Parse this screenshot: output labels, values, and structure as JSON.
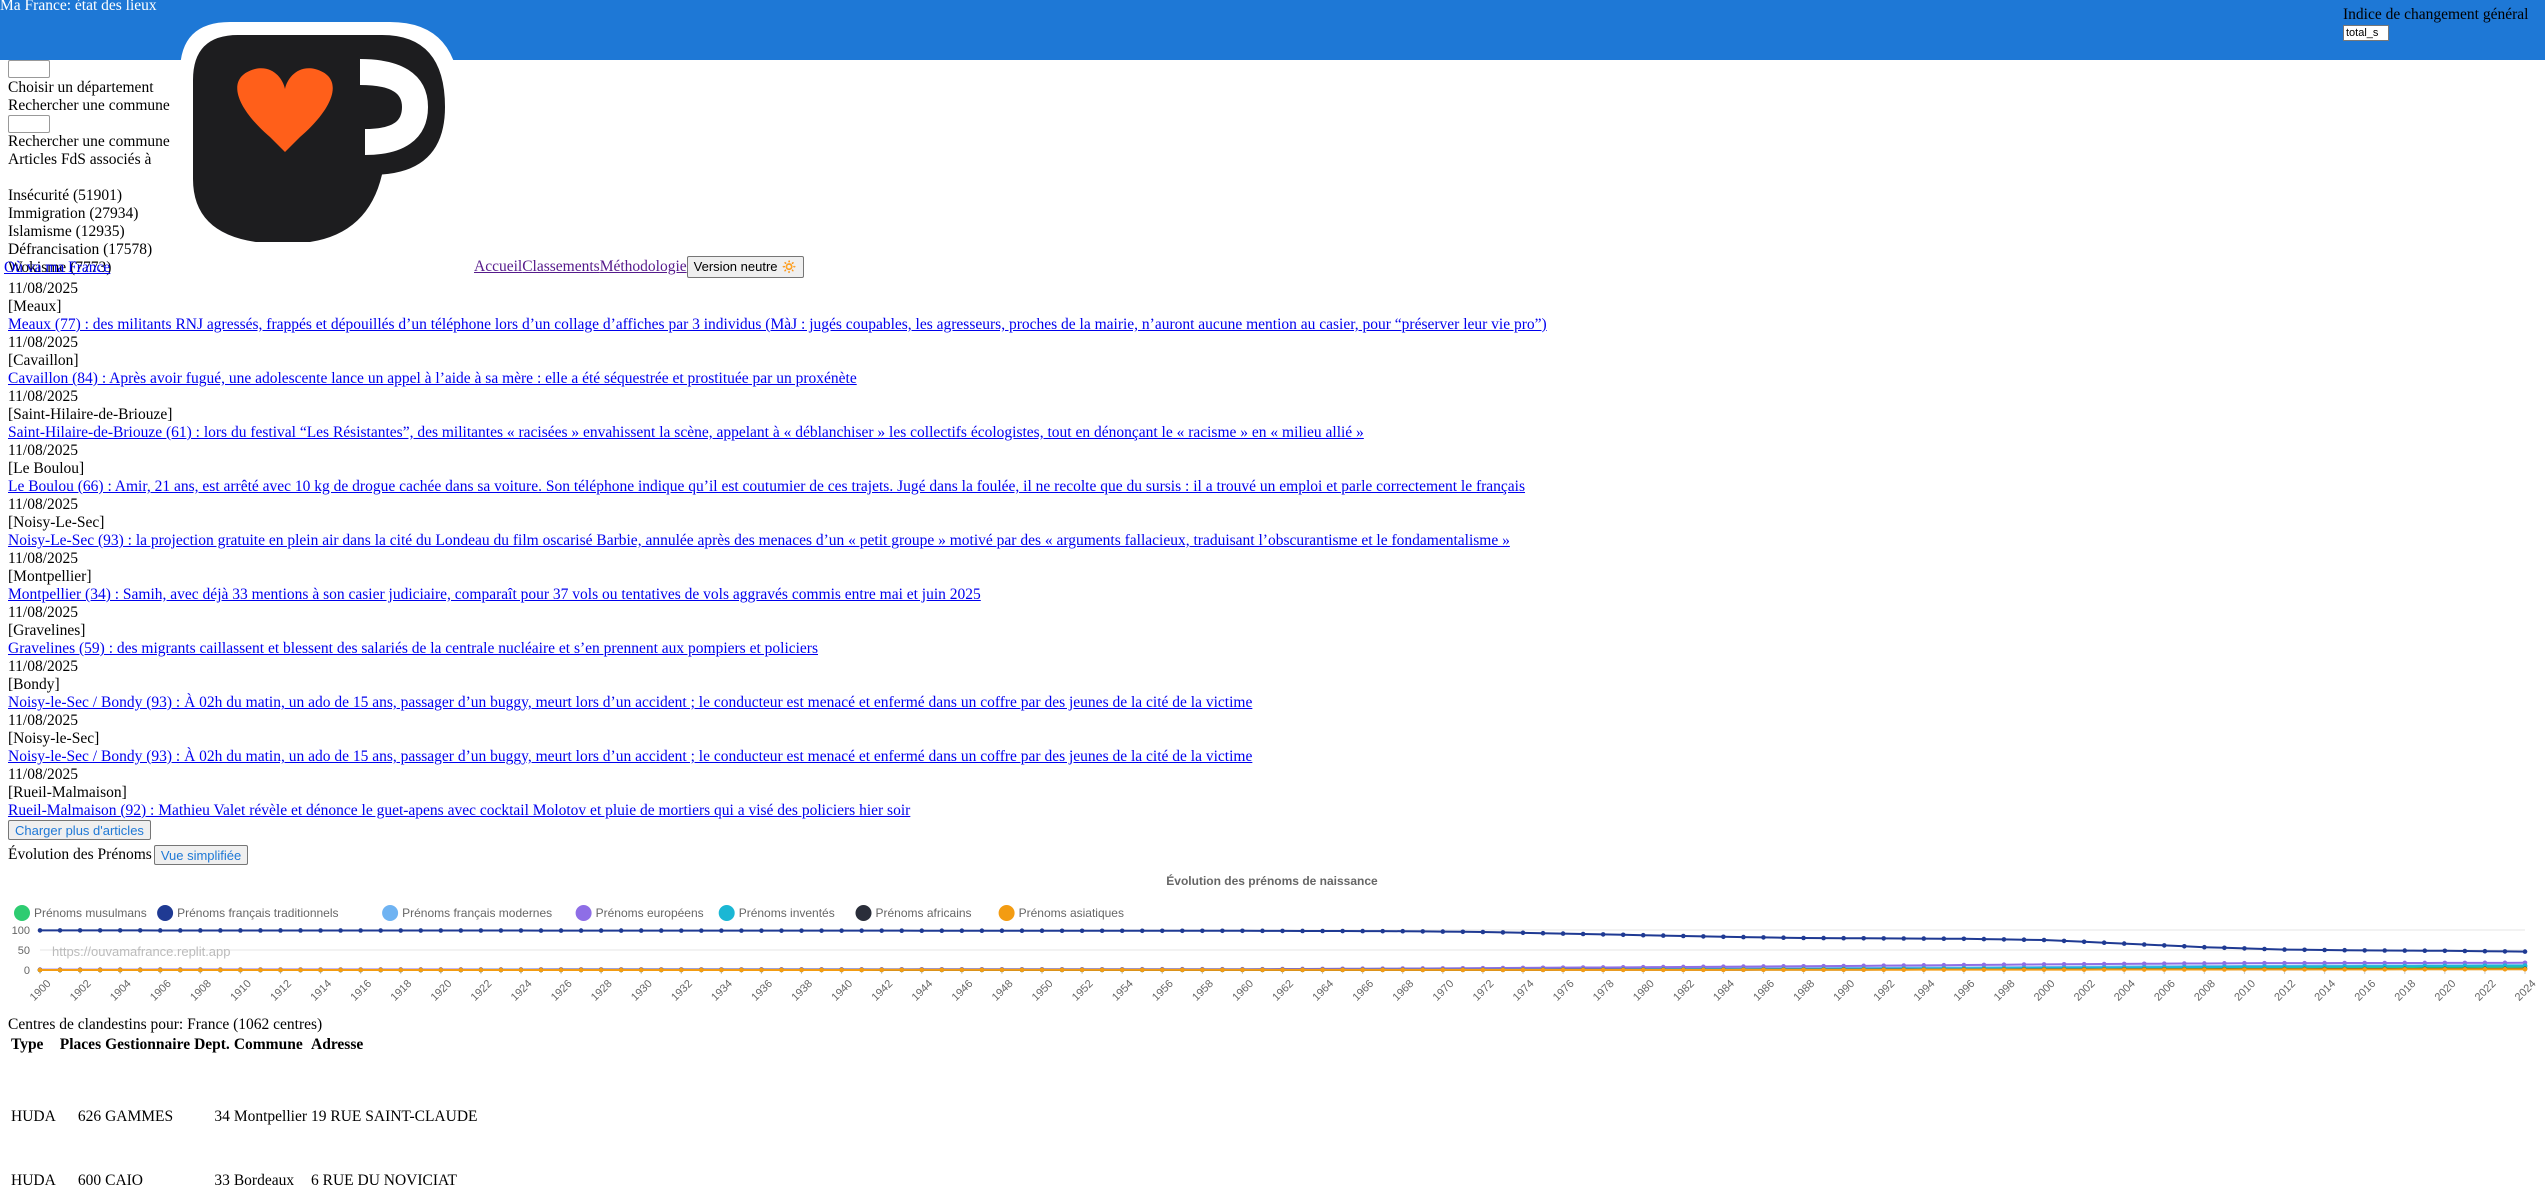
{
  "header": {
    "title": "Ma France: état des lieux",
    "indice_label": "Indice de changement général",
    "indice_value": "total_s"
  },
  "left": {
    "choose_dept": "Choisir un département",
    "search_commune": "Rechercher une commune",
    "search_commune_2": "Rechercher une commune",
    "articles_assoc": "Articles FdS associés à"
  },
  "categories": [
    "Insécurité (51901)",
    "Immigration (27934)",
    "Islamisme (12935)",
    "Défrancisation (17578)",
    "Wokisme (7773)"
  ],
  "nav": {
    "overlay_link": "Où va ma France",
    "accueil": "Accueil",
    "classements": "Classements",
    "methodologie": "Méthodologie",
    "neutral_button": "Version neutre 🔅"
  },
  "articles": [
    {
      "date": "11/08/2025",
      "place": "[Meaux]",
      "title": "Meaux (77) : des militants RNJ agressés, frappés et dépouillés d’un téléphone lors d’un collage d’affiches par 3 individus (MàJ : jugés coupables, les agresseurs, proches de la mairie, n’auront aucune mention au casier, pour “préserver leur vie pro”)"
    },
    {
      "date": "11/08/2025",
      "place": "[Cavaillon]",
      "title": "Cavaillon (84) : Après avoir fugué, une adolescente lance un appel à l’aide à sa mère : elle a été séquestrée et prostituée par un proxénète"
    },
    {
      "date": "11/08/2025",
      "place": "[Saint-Hilaire-de-Briouze]",
      "title": "Saint-Hilaire-de-Briouze (61) : lors du festival “Les Résistantes”, des militantes « racisées » envahissent la scène, appelant à « déblanchiser » les collectifs écologistes, tout en dénonçant le « racisme » en « milieu allié »"
    },
    {
      "date": "11/08/2025",
      "place": "[Le Boulou]",
      "title": "Le Boulou (66) : Amir, 21 ans, est arrêté avec 10 kg de drogue cachée dans sa voiture. Son téléphone indique qu’il est coutumier de ces trajets. Jugé dans la foulée, il ne recolte que du sursis : il a trouvé un emploi et parle correctement le français"
    },
    {
      "date": "11/08/2025",
      "place": "[Noisy-Le-Sec]",
      "title": "Noisy-Le-Sec (93) : la projection gratuite en plein air dans la cité du Londeau du film oscarisé Barbie, annulée après des menaces d’un « petit groupe » motivé par des « arguments fallacieux, traduisant l’obscurantisme et le fondamentalisme »"
    },
    {
      "date": "11/08/2025",
      "place": "[Montpellier]",
      "title": "Montpellier (34) : Samih, avec déjà 33 mentions à son casier judiciaire, comparaît pour 37 vols ou tentatives de vols aggravés commis entre mai et juin 2025"
    },
    {
      "date": "11/08/2025",
      "place": "[Gravelines]",
      "title": "Gravelines (59) : des migrants caillassent et blessent des salariés de la centrale nucléaire et s’en prennent aux pompiers et policiers"
    },
    {
      "date": "11/08/2025",
      "place": "[Bondy]",
      "title": "Noisy-le-Sec / Bondy (93) : À 02h du matin, un ado de 15 ans, passager d’un buggy, meurt lors d’un accident ; le conducteur est menacé et enfermé dans un coffre par des jeunes de la cité de la victime"
    },
    {
      "date": "11/08/2025",
      "place": "[Noisy-le-Sec]",
      "title": "Noisy-le-Sec / Bondy (93) : À 02h du matin, un ado de 15 ans, passager d’un buggy, meurt lors d’un accident ; le conducteur est menacé et enfermé dans un coffre par des jeunes de la cité de la victime"
    },
    {
      "date": "11/08/2025",
      "place": "[Rueil-Malmaison]",
      "title": "Rueil-Malmaison (92) : Mathieu Valet révèle et dénonce le guet-apens avec cocktail Molotov et pluie de mortiers qui a visé des policiers hier soir"
    }
  ],
  "load_more": "Charger plus d'articles",
  "prenoms": {
    "label": "Évolution des Prénoms",
    "simplified_button": "Vue simplifiée"
  },
  "chart_data": {
    "type": "line",
    "title": "Évolution des prénoms de naissance",
    "watermark": "https://ouvamafrance.replit.app",
    "ylim": [
      0,
      100
    ],
    "yticks": [
      0,
      50,
      100
    ],
    "x": [
      1900,
      1901,
      1902,
      1903,
      1904,
      1905,
      1906,
      1907,
      1908,
      1909,
      1910,
      1911,
      1912,
      1913,
      1914,
      1915,
      1916,
      1917,
      1918,
      1919,
      1920,
      1921,
      1922,
      1923,
      1924,
      1925,
      1926,
      1927,
      1928,
      1929,
      1930,
      1931,
      1932,
      1933,
      1934,
      1935,
      1936,
      1937,
      1938,
      1939,
      1940,
      1941,
      1942,
      1943,
      1944,
      1945,
      1946,
      1947,
      1948,
      1949,
      1950,
      1951,
      1952,
      1953,
      1954,
      1955,
      1956,
      1957,
      1958,
      1959,
      1960,
      1961,
      1962,
      1963,
      1964,
      1965,
      1966,
      1967,
      1968,
      1969,
      1970,
      1971,
      1972,
      1973,
      1974,
      1975,
      1976,
      1977,
      1978,
      1979,
      1980,
      1981,
      1982,
      1983,
      1984,
      1985,
      1986,
      1987,
      1988,
      1989,
      1990,
      1991,
      1992,
      1993,
      1994,
      1995,
      1996,
      1997,
      1998,
      1999,
      2000,
      2001,
      2002,
      2003,
      2004,
      2005,
      2006,
      2007,
      2008,
      2009,
      2010,
      2011,
      2012,
      2013,
      2014,
      2015,
      2016,
      2017,
      2018,
      2019,
      2020,
      2021,
      2022,
      2023,
      2024
    ],
    "xticks": [
      1900,
      1902,
      1904,
      1906,
      1908,
      1910,
      1912,
      1914,
      1916,
      1918,
      1920,
      1922,
      1924,
      1926,
      1928,
      1930,
      1932,
      1934,
      1936,
      1938,
      1940,
      1942,
      1944,
      1946,
      1948,
      1950,
      1952,
      1954,
      1956,
      1958,
      1960,
      1962,
      1964,
      1966,
      1968,
      1970,
      1972,
      1974,
      1976,
      1978,
      1980,
      1982,
      1984,
      1986,
      1988,
      1990,
      1992,
      1994,
      1996,
      1998,
      2000,
      2002,
      2004,
      2006,
      2008,
      2010,
      2012,
      2014,
      2016,
      2018,
      2020,
      2022,
      2024
    ],
    "series": [
      {
        "name": "Prénoms musulmans",
        "color": "#2ecc71",
        "anchors": [
          [
            1900,
            0
          ],
          [
            1960,
            0.3
          ],
          [
            1970,
            1
          ],
          [
            1980,
            2
          ],
          [
            1990,
            3
          ],
          [
            2000,
            4
          ],
          [
            2010,
            6
          ],
          [
            2024,
            8
          ]
        ]
      },
      {
        "name": "Prénoms français traditionnels",
        "color": "#1f3a93",
        "anchors": [
          [
            1900,
            99
          ],
          [
            1960,
            98
          ],
          [
            1968,
            97
          ],
          [
            1972,
            95
          ],
          [
            1976,
            91
          ],
          [
            1980,
            87
          ],
          [
            1984,
            83
          ],
          [
            1988,
            80
          ],
          [
            1992,
            79
          ],
          [
            1996,
            78
          ],
          [
            2000,
            75
          ],
          [
            2004,
            66
          ],
          [
            2008,
            57
          ],
          [
            2012,
            51
          ],
          [
            2016,
            49
          ],
          [
            2020,
            48
          ],
          [
            2024,
            46
          ]
        ]
      },
      {
        "name": "Prénoms français modernes",
        "color": "#6fb3f2",
        "anchors": [
          [
            1900,
            0
          ],
          [
            1965,
            0.5
          ],
          [
            1975,
            2
          ],
          [
            1985,
            4
          ],
          [
            1995,
            6
          ],
          [
            2005,
            9
          ],
          [
            2015,
            11
          ],
          [
            2024,
            12
          ]
        ]
      },
      {
        "name": "Prénoms européens",
        "color": "#8e6ee6",
        "anchors": [
          [
            1900,
            1
          ],
          [
            1960,
            2
          ],
          [
            1970,
            4
          ],
          [
            1980,
            7
          ],
          [
            1990,
            10
          ],
          [
            2000,
            14
          ],
          [
            2010,
            17
          ],
          [
            2024,
            18
          ]
        ]
      },
      {
        "name": "Prénoms inventés",
        "color": "#1bb7d4",
        "anchors": [
          [
            1900,
            0
          ],
          [
            1970,
            0.5
          ],
          [
            1985,
            2
          ],
          [
            2000,
            5
          ],
          [
            2010,
            8
          ],
          [
            2024,
            11
          ]
        ]
      },
      {
        "name": "Prénoms africains",
        "color": "#2a2e3a",
        "anchors": [
          [
            1900,
            0
          ],
          [
            1980,
            0.5
          ],
          [
            2000,
            1.5
          ],
          [
            2024,
            3
          ]
        ]
      },
      {
        "name": "Prénoms asiatiques",
        "color": "#f39c12",
        "anchors": [
          [
            1900,
            0
          ],
          [
            1980,
            0.3
          ],
          [
            2000,
            1
          ],
          [
            2024,
            2
          ]
        ]
      }
    ]
  },
  "centres": {
    "title": "Centres de clandestins pour: France (1062 centres)",
    "headers": [
      "Type",
      "Places",
      "Gestionnaire",
      "Dept.",
      "Commune",
      "Adresse"
    ],
    "rows": [
      [
        "HUDA",
        "626",
        "GAMMES",
        "34",
        "Montpellier",
        "19 RUE SAINT-CLAUDE"
      ],
      [
        "HUDA",
        "600",
        "CAIO",
        "33",
        "Bordeaux",
        "6 RUE DU NOVICIAT"
      ]
    ]
  },
  "colors": {
    "header_bar": "#1e78d6",
    "link": "#0000ee",
    "visited": "#551a8b"
  }
}
